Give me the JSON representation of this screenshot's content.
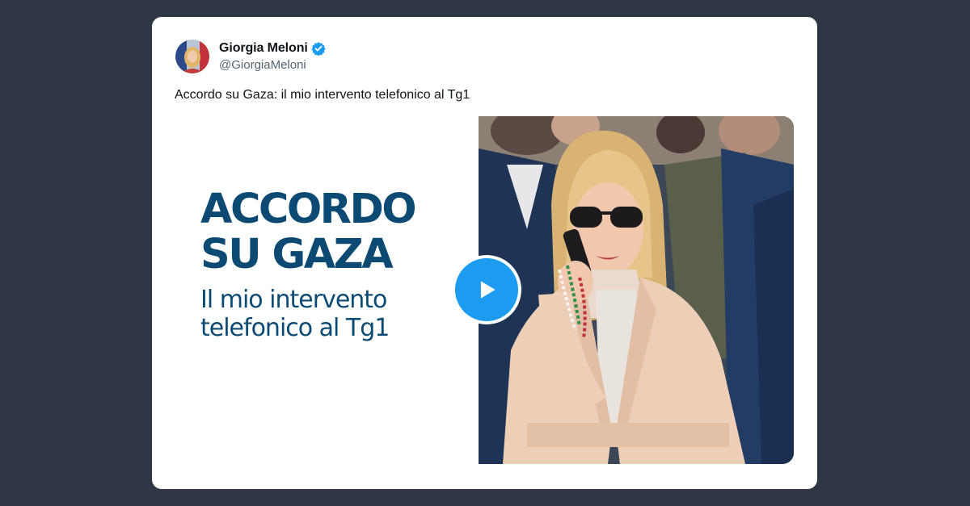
{
  "tweet": {
    "author_name": "Giorgia Meloni",
    "handle": "@GiorgiaMeloni",
    "verified": true,
    "text": "Accordo su Gaza: il mio intervento telefonico al Tg1"
  },
  "media": {
    "type": "video",
    "headline_line1": "ACCORDO",
    "headline_line2": "SU GAZA",
    "subtitle_line1": "Il mio intervento",
    "subtitle_line2": "telefonico al Tg1",
    "play_icon": "play-icon"
  },
  "colors": {
    "background": "#2f3746",
    "card": "#ffffff",
    "headline": "#0c4a74",
    "accent": "#1d9bf0",
    "handle": "#536471"
  }
}
